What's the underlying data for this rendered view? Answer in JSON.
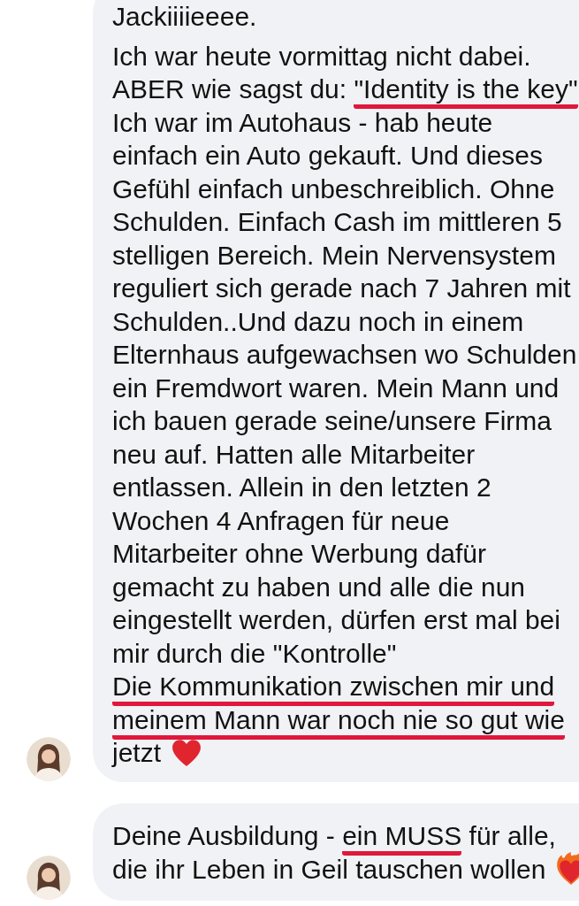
{
  "messages": [
    {
      "lines": [
        [
          {
            "text": "Jackiiiieeee.",
            "marked": false
          }
        ],
        [
          {
            "text": "Ich war heute vormittag nicht dabei.",
            "marked": false
          }
        ],
        [
          {
            "text": "ABER wie sagst du: ",
            "marked": false
          },
          {
            "text": "\"Identity is the key\"",
            "marked": true
          }
        ],
        [
          {
            "text": "Ich war im Autohaus - hab heute",
            "marked": false
          }
        ],
        [
          {
            "text": "einfach ein Auto gekauft. Und dieses",
            "marked": false
          }
        ],
        [
          {
            "text": "Gefühl einfach unbeschreiblich. Ohne",
            "marked": false
          }
        ],
        [
          {
            "text": "Schulden. Einfach Cash im mittleren 5",
            "marked": false
          }
        ],
        [
          {
            "text": "stelligen Bereich. Mein Nervensystem",
            "marked": false
          }
        ],
        [
          {
            "text": "reguliert sich gerade nach 7 Jahren mit",
            "marked": false
          }
        ],
        [
          {
            "text": "Schulden..Und dazu noch in einem",
            "marked": false
          }
        ],
        [
          {
            "text": "Elternhaus aufgewachsen wo Schulden",
            "marked": false
          }
        ],
        [
          {
            "text": "ein Fremdwort waren. Mein Mann und",
            "marked": false
          }
        ],
        [
          {
            "text": "ich bauen gerade seine/unsere Firma",
            "marked": false
          }
        ],
        [
          {
            "text": "neu auf. Hatten alle Mitarbeiter",
            "marked": false
          }
        ],
        [
          {
            "text": "entlassen. Allein in den letzten 2",
            "marked": false
          }
        ],
        [
          {
            "text": "Wochen 4 Anfragen für neue",
            "marked": false
          }
        ],
        [
          {
            "text": "Mitarbeiter ohne Werbung dafür",
            "marked": false
          }
        ],
        [
          {
            "text": "gemacht zu haben und alle die nun",
            "marked": false
          }
        ],
        [
          {
            "text": "eingestellt werden, dürfen erst mal bei",
            "marked": false
          }
        ],
        [
          {
            "text": "mir durch die \"Kontrolle\"",
            "marked": false
          }
        ],
        [
          {
            "text": "Die Kommunikation zwischen mir und",
            "marked": true
          }
        ],
        [
          {
            "text": "meinem Mann war noch nie so gut wie",
            "marked": true
          }
        ],
        [
          {
            "text": "jetzt",
            "marked": false
          }
        ]
      ],
      "end_icon": {
        "kind": "heart"
      }
    },
    {
      "lines": [
        [
          {
            "text": "Deine Ausbildung - ",
            "marked": false
          },
          {
            "text": "ein MUSS",
            "marked": true
          },
          {
            "text": " für alle,",
            "marked": false
          }
        ],
        [
          {
            "text": "die ihr Leben in Geil tauschen wollen",
            "marked": false
          }
        ]
      ],
      "end_icon": {
        "kind": "heart-on-fire"
      }
    }
  ]
}
